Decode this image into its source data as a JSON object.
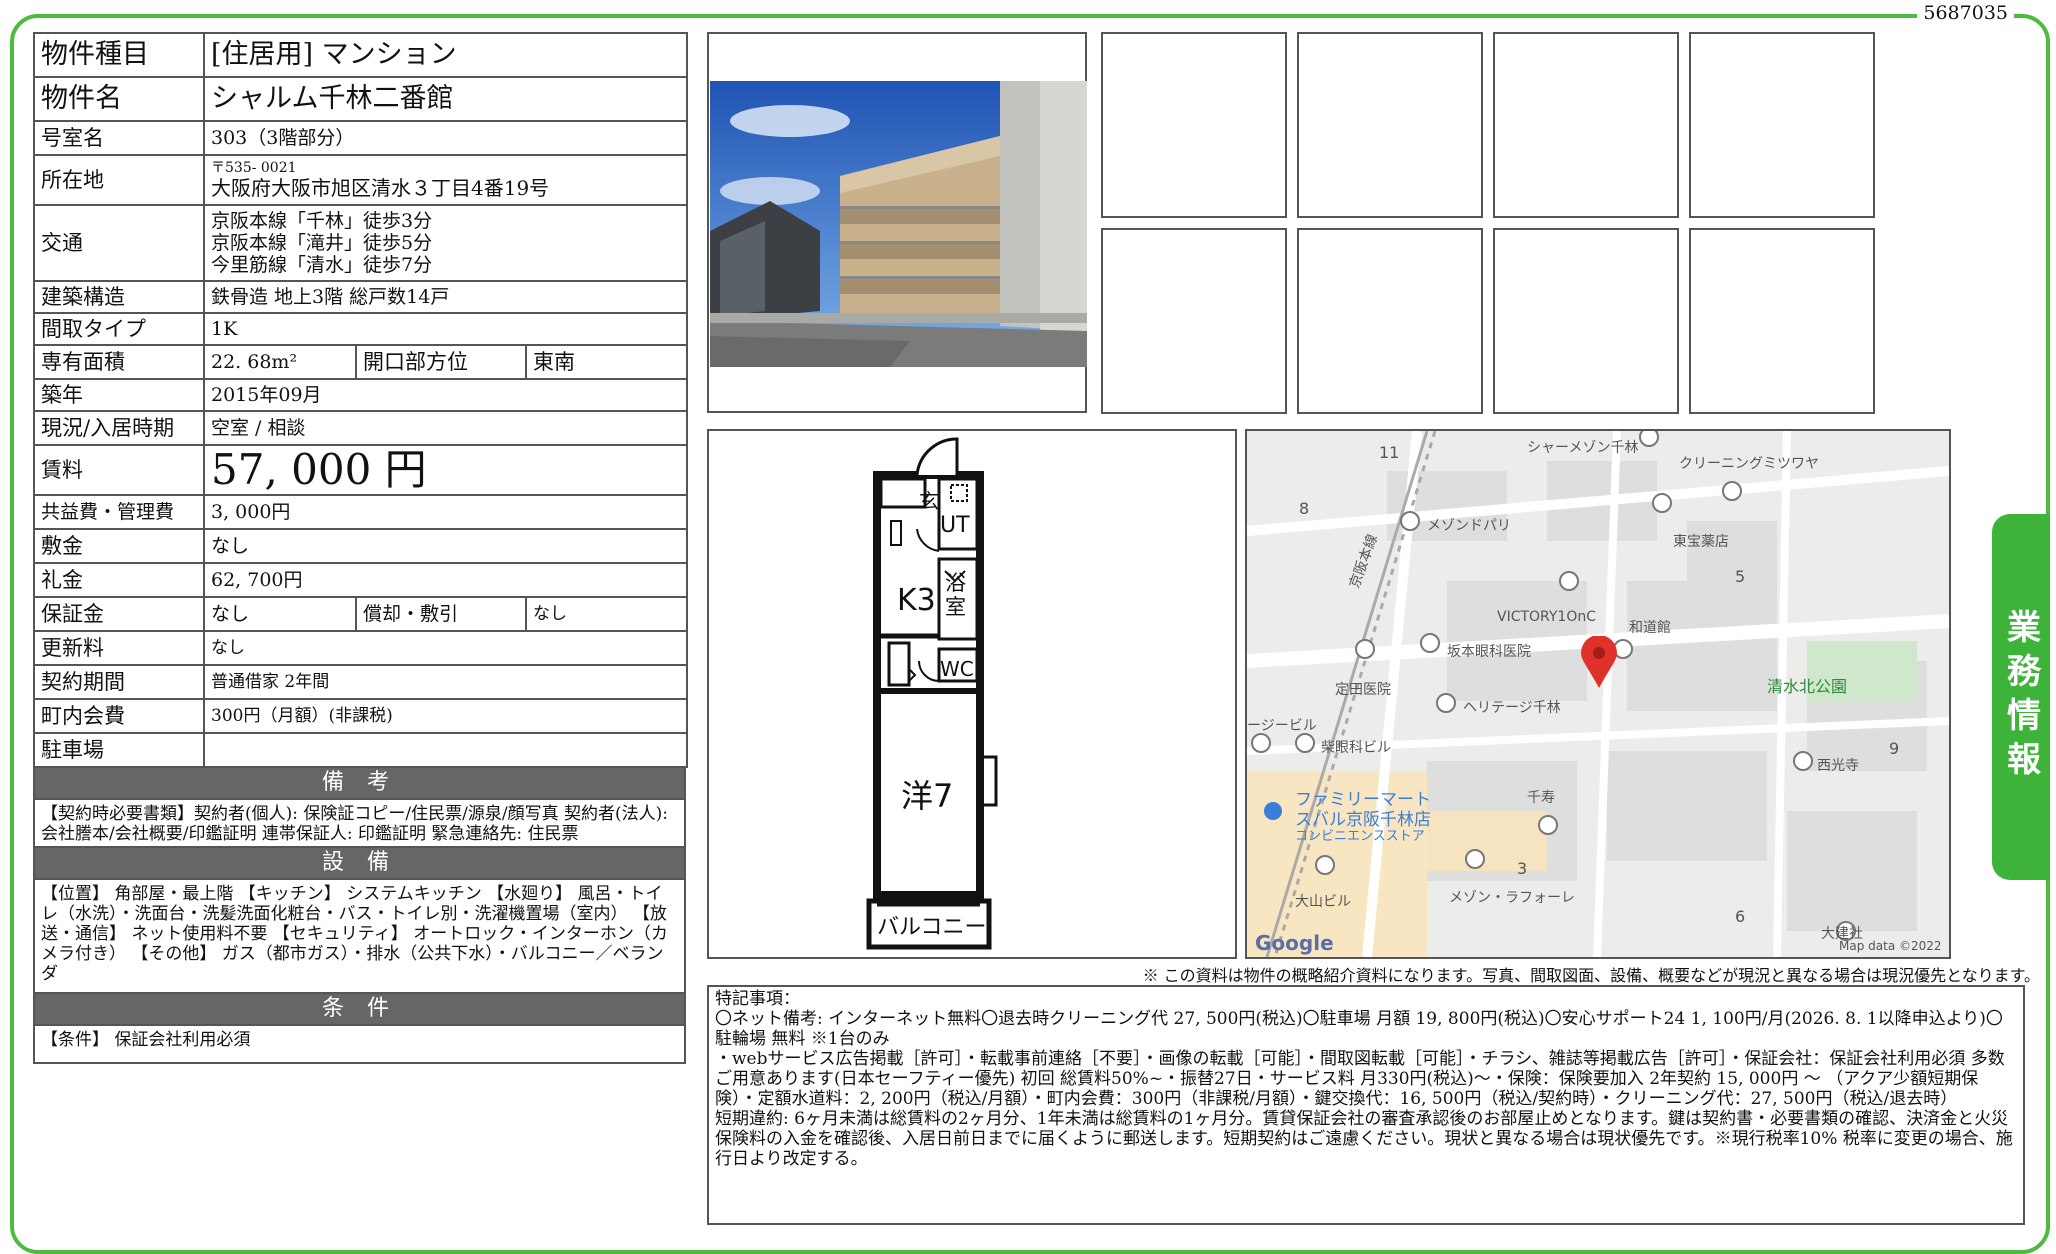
{
  "doc_id": "5687035",
  "side_tab": "業務情報",
  "rows": {
    "type": {
      "label": "物件種目",
      "value": "[住居用]  マンション"
    },
    "name": {
      "label": "物件名",
      "value": "シャルム千林二番館"
    },
    "room": {
      "label": "号室名",
      "value": "303（3階部分）"
    },
    "address": {
      "label": "所在地",
      "zip": "〒535- 0021",
      "value": "大阪府大阪市旭区清水３丁目4番19号"
    },
    "transport": {
      "label": "交通",
      "lines": [
        "京阪本線「千林」徒歩3分",
        "京阪本線「滝井」徒歩5分",
        "今里筋線「清水」徒歩7分"
      ]
    },
    "structure": {
      "label": "建築構造",
      "value": "鉄骨造  地上3階  総戸数14戸"
    },
    "layout": {
      "label": "間取タイプ",
      "value": "1K"
    },
    "area": {
      "label": "専有面積",
      "value": "22. 68m²",
      "label2": "開口部方位",
      "value2": "東南"
    },
    "built": {
      "label": "築年",
      "value": "2015年09月"
    },
    "status": {
      "label": "現況/入居時期",
      "value": "空室  /  相談"
    },
    "rent": {
      "label": "賃料",
      "value": "57, 000  円"
    },
    "common": {
      "label": "共益費・管理費",
      "value": "3, 000円"
    },
    "deposit": {
      "label": "敷金",
      "value": "なし"
    },
    "key_money": {
      "label": "礼金",
      "value": "62, 700円"
    },
    "guarantee": {
      "label": "保証金",
      "value": "なし",
      "label2": "償却・敷引",
      "value2": "なし"
    },
    "renewal": {
      "label": "更新料",
      "value": "なし"
    },
    "contract": {
      "label": "契約期間",
      "value": "普通借家  2年間"
    },
    "town_fee": {
      "label": "町内会費",
      "value": "300円（月額）(非課税)"
    },
    "parking": {
      "label": "駐車場",
      "value": ""
    }
  },
  "biko": {
    "title": "備 考",
    "text": "【契約時必要書類】契約者(個人): 保険証コピー/住民票/源泉/顔写真   契約者(法人): 会社謄本/会社概要/印鑑証明   連帯保証人: 印鑑証明   緊急連絡先: 住民票"
  },
  "setsubi": {
    "title": "設 備",
    "text": "【位置】 角部屋・最上階 【キッチン】 システムキッチン 【水廻り】 風呂・トイレ（水洗）・洗面台・洗髪洗面化粧台・バス・トイレ別・洗濯機置場（室内） 【放送・通信】 ネット使用料不要 【セキュリティ】 オートロック・インターホン（カメラ付き） 【その他】 ガス（都市ガス）・排水（公共下水）・バルコニー／ベランダ"
  },
  "joken": {
    "title": "条 件",
    "text": "【条件】 保証会社利用必須"
  },
  "floor_plan": {
    "entrance": "玄",
    "ut": "UT",
    "kitchen": "K3",
    "bath": "浴室",
    "wc": "WC",
    "western": "洋7",
    "balcony": "バルコニー"
  },
  "map": {
    "labels": {
      "maison_senbayashi": "シャーメゾン千林",
      "cleaning": "クリーニングミツワヤ",
      "maison_doparu": "メゾンドパリ",
      "tohou": "東宝薬店",
      "victory": "VICTORY1OnC",
      "wado": "和道館",
      "sakamoto": "坂本眼科医院",
      "sadata": "定田医院",
      "heritage": "ヘリテージ千林",
      "shimizu_park": "清水北公園",
      "building": "ージービル",
      "shiba": "柴眼科ビル",
      "familymart1": "ファミリーマート",
      "familymart2": "スバル京阪千林店",
      "familymart3": "コンビニエンスストア",
      "chitose": "千寿",
      "saikoji": "西光寺",
      "oyama": "大山ビル",
      "maison_laforet": "メゾン・ラフォーレ",
      "okensha": "大建社",
      "keihan_line": "京阪本線",
      "google": "Google",
      "mapdata": "Map data ©2022"
    },
    "numbers": [
      "11",
      "8",
      "5",
      "9",
      "3",
      "6"
    ]
  },
  "disclaimer": "※ この資料は物件の概略紹介資料になります。写真、間取図面、設備、概要などが現況と異なる場合は現況優先となります。",
  "remarks": {
    "title": "特記事項：",
    "lines": [
      "〇ネット備考: インターネット無料〇退去時クリーニング代   27, 500円(税込)〇駐車場   月額   19, 800円(税込)〇安心サポート24  1, 100円/月(2026. 8. 1以降申込より)〇駐輪場   無料   ※1台のみ",
      "・webサービス広告掲載［許可］・転載事前連絡［不要］・画像の転載［可能］・間取図転載［可能］・チラシ、雑誌等掲載広告［許可］・保証会社：保証会社利用必須   多数ご用意あります(日本セーフティー優先)  初回  総賃料50%~・振替27日・サービス料  月330円(税込)～・保険：保険要加入  2年契約 15, 000円 ～  （アクア少額短期保険）・定額水道料：2, 200円（税込/月額）・町内会費：300円（非課税/月額）・鍵交換代：16, 500円（税込/契約時）・クリーニング代：27, 500円（税込/退去時）",
      "短期違約: 6ヶ月未満は総賃料の2ヶ月分、1年未満は総賃料の1ヶ月分。賃貸保証会社の審査承認後のお部屋止めとなります。鍵は契約書・必要書類の確認、決済金と火災保険料の入金を確認後、入居日前日までに届くように郵送します。短期契約はご遠慮ください。現状と異なる場合は現状優先です。※現行税率10%  税率に変更の場合、施行日より改定する。"
    ]
  }
}
